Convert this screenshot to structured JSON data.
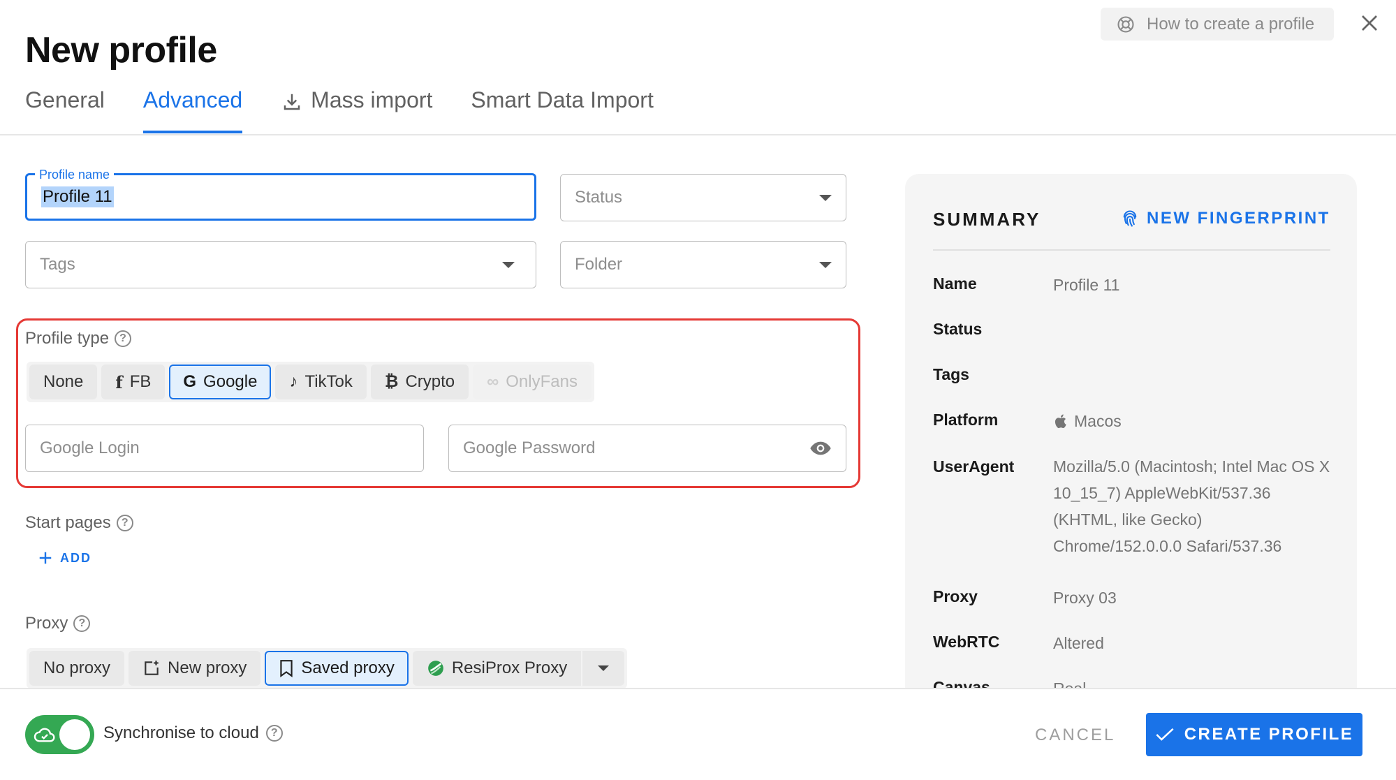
{
  "header": {
    "title": "New profile",
    "help_label": "How to create a profile"
  },
  "tabs": [
    {
      "label": "General",
      "active": false
    },
    {
      "label": "Advanced",
      "active": true
    },
    {
      "label": "Mass import",
      "active": false,
      "icon": "download-icon"
    },
    {
      "label": "Smart Data Import",
      "active": false
    }
  ],
  "form": {
    "profile_name": {
      "label": "Profile name",
      "value": "Profile 11"
    },
    "status": {
      "placeholder": "Status"
    },
    "tags": {
      "placeholder": "Tags"
    },
    "folder": {
      "placeholder": "Folder"
    },
    "profile_type": {
      "label": "Profile type",
      "options": [
        {
          "label": "None",
          "icon": "",
          "state": "default"
        },
        {
          "label": "FB",
          "icon": "facebook-icon",
          "state": "default"
        },
        {
          "label": "Google",
          "icon": "google-icon",
          "state": "selected"
        },
        {
          "label": "TikTok",
          "icon": "tiktok-icon",
          "state": "default"
        },
        {
          "label": "Crypto",
          "icon": "bitcoin-icon",
          "state": "default"
        },
        {
          "label": "OnlyFans",
          "icon": "onlyfans-icon",
          "state": "disabled"
        }
      ],
      "google_login": {
        "placeholder": "Google Login"
      },
      "google_password": {
        "placeholder": "Google Password"
      }
    },
    "start_pages": {
      "label": "Start pages",
      "add_label": "ADD"
    },
    "proxy": {
      "label": "Proxy",
      "options": [
        {
          "label": "No proxy",
          "icon": "",
          "state": "default"
        },
        {
          "label": "New proxy",
          "icon": "new-proxy-icon",
          "state": "default"
        },
        {
          "label": "Saved proxy",
          "icon": "bookmark-icon",
          "state": "selected"
        },
        {
          "label": "ResiProx Proxy",
          "icon": "resiprox-icon",
          "state": "default"
        }
      ]
    }
  },
  "summary": {
    "heading": "SUMMARY",
    "new_fingerprint": "NEW FINGERPRINT",
    "rows": [
      {
        "key": "Name",
        "value": "Profile 11"
      },
      {
        "key": "Status",
        "value": ""
      },
      {
        "key": "Tags",
        "value": ""
      },
      {
        "key": "Platform",
        "value": "Macos"
      },
      {
        "key": "UserAgent",
        "value": "Mozilla/5.0 (Macintosh; Intel Mac OS X 10_15_7) AppleWebKit/537.36 (KHTML, like Gecko) Chrome/152.0.0.0 Safari/537.36"
      },
      {
        "key": "Proxy",
        "value": "Proxy 03"
      },
      {
        "key": "WebRTC",
        "value": "Altered"
      },
      {
        "key": "Canvas",
        "value": "Real"
      }
    ]
  },
  "footer": {
    "sync_label": "Synchronise to cloud",
    "sync_enabled": true,
    "cancel_label": "CANCEL",
    "create_label": "CREATE PROFILE"
  },
  "colors": {
    "accent": "#1a73e8",
    "highlight_border": "#e53935",
    "toggle_on": "#34a853"
  }
}
